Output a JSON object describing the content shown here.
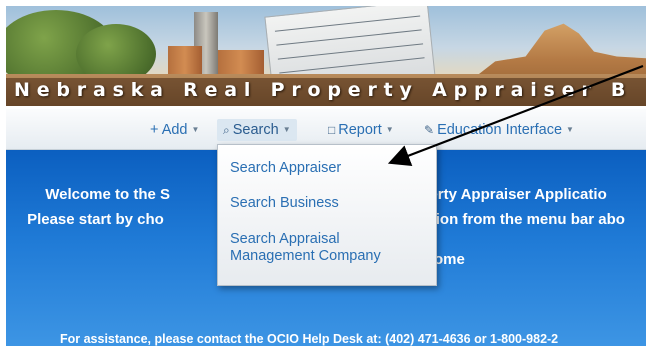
{
  "banner": {
    "title": "Nebraska Real Property Appraiser B"
  },
  "nav": {
    "items": [
      {
        "label": "+ Add",
        "icon": "plus-icon"
      },
      {
        "label": "Search",
        "icon": "search-icon"
      },
      {
        "label": "Report",
        "icon": "report-icon"
      },
      {
        "label": "Education Interface",
        "icon": "pencil-icon"
      }
    ]
  },
  "dropdown": {
    "items": [
      {
        "label": "Search Appraiser"
      },
      {
        "label": "Search Business"
      },
      {
        "label": "Search Appraisal Management Company"
      }
    ]
  },
  "content": {
    "welcome_start": "Welcome to the S",
    "welcome_end": "perty Appraiser Applicatio",
    "instruction_start": "Please start by cho",
    "instruction_end": "tion from the menu bar abo",
    "home_fragment": "ome",
    "assistance": "For assistance, please contact the OCIO Help Desk at: (402) 471-4636 or 1-800-982-2"
  },
  "colors": {
    "link": "#2a6fb3",
    "content_blue": "#1f7ad6"
  }
}
